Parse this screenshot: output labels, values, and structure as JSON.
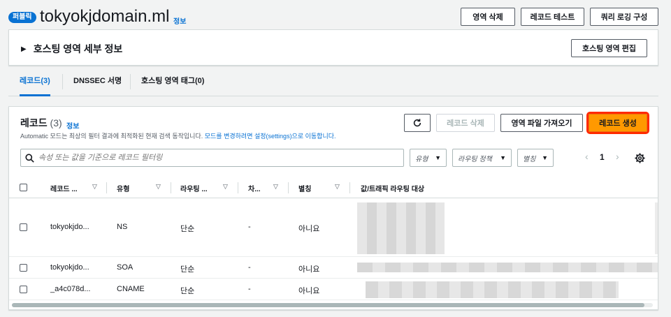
{
  "header": {
    "badge": "퍼블릭",
    "title": "tokyokjdomain.ml",
    "info": "정보",
    "buttons": {
      "delete_zone": "영역 삭제",
      "test_record": "레코드 테스트",
      "query_logging": "쿼리 로깅 구성"
    }
  },
  "hosted_zone": {
    "title": "호스팅 영역 세부 정보",
    "edit_button": "호스팅 영역 편집"
  },
  "tabs": [
    {
      "label": "레코드(3)",
      "active": true
    },
    {
      "label": "DNSSEC 서명",
      "active": false
    },
    {
      "label": "호스팅 영역 태그(0)",
      "active": false
    }
  ],
  "records": {
    "title": "레코드",
    "count": "(3)",
    "info": "정보",
    "description": "Automatic 모드는 최상의 필터 결과에 최적화된 현재 검색 동작입니다. ",
    "description_link": "모드를 변경하려면 설정(settings)으로 이동합니다.",
    "buttons": {
      "delete": "레코드 삭제",
      "import": "영역 파일 가져오기",
      "create": "레코드 생성"
    },
    "search_placeholder": "속성 또는 값을 기준으로 레코드 필터링",
    "filters": {
      "type": "유형",
      "routing": "라우팅 정책",
      "alias": "별칭"
    },
    "page": "1",
    "columns": [
      "레코드 ...",
      "유형",
      "라우팅 ...",
      "차...",
      "별칭",
      "값/트래픽 라우팅 대상"
    ],
    "rows": [
      {
        "name": "tokyokjdo...",
        "type": "NS",
        "routing": "단순",
        "diff": "-",
        "alias": "아니요"
      },
      {
        "name": "tokyokjdo...",
        "type": "SOA",
        "routing": "단순",
        "diff": "-",
        "alias": "아니요"
      },
      {
        "name": "_a4c078d...",
        "type": "CNAME",
        "routing": "단순",
        "diff": "-",
        "alias": "아니요"
      }
    ]
  },
  "colors": {
    "accent": "#0972d3",
    "primary": "#ff9900",
    "highlight": "#ff2a00"
  }
}
